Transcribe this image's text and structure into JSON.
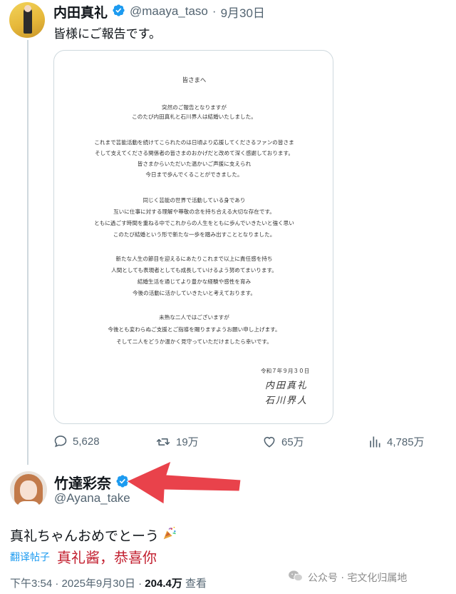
{
  "tweet1": {
    "display_name": "内田真礼",
    "handle": "@maaya_taso",
    "separator": "·",
    "date": "9月30日",
    "text": "皆様にご報告です。",
    "letter": {
      "salutation": "皆さまへ",
      "para1": [
        "突然のご報告となりますが",
        "このたび内田真礼と石川界人は結婚いたしました。"
      ],
      "para2": [
        "これまで芸能活動を続けてこられたのは日頃より応援してくださるファンの皆さま",
        "そして支えてくださる関係者の皆さまのおかげだと改めて深く感謝しております。",
        "皆さまからいただいた温かいご声援に支えられ",
        "今日まで歩んでくることができました。"
      ],
      "para3": [
        "同じく芸能の世界で活動している身であり",
        "互いに仕事に対する理解や尊敬の念を持ち合える大切な存在です。",
        "ともに過ごす時間を重ねる中でこれからの人生をともに歩んでいきたいと強く思い",
        "このたび結婚という形で新たな一歩を踏み出すこととなりました。"
      ],
      "para4": [
        "新たな人生の節目を迎えるにあたりこれまで以上に責任感を持ち",
        "人間としても表現者としても成長していけるよう努めてまいります。",
        "結婚生活を通じてより豊かな経験や感性を育み",
        "今後の活動に活かしていきたいと考えております。"
      ],
      "para5": [
        "未熟な二人ではございますが",
        "今後とも変わらぬご支援とご指導を賜りますようお願い申し上げます。",
        "そして二人をどうか温かく見守っていただけましたら幸いです。"
      ],
      "date": "令和７年９月３０日",
      "signature1": "内田真礼",
      "signature2": "石川界人"
    },
    "stats": {
      "replies": "5,628",
      "retweets": "19万",
      "likes": "65万",
      "views": "4,785万"
    }
  },
  "tweet2": {
    "display_name": "竹達彩奈",
    "handle": "@Ayana_take",
    "text": "真礼ちゃんおめでとーう",
    "translate_label": "翻译帖子",
    "translation": "真礼酱，恭喜你",
    "time": "下午3:54",
    "date": "2025年9月30日",
    "views_value": "204.4万",
    "views_label": "查看",
    "separator": "·"
  },
  "watermark": {
    "text": "公众号 · 宅文化归属地"
  },
  "colors": {
    "verified": "#1d9bf0",
    "arrow": "#e8323c",
    "translation": "#c21e2e",
    "muted": "#536471"
  }
}
